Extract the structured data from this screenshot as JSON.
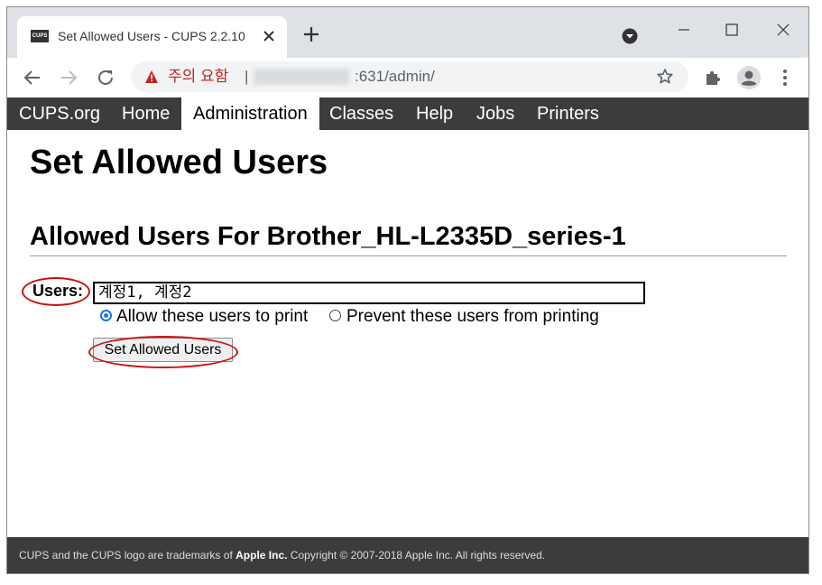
{
  "browser": {
    "tab_title": "Set Allowed Users - CUPS 2.2.10",
    "favicon_text": "CUPS",
    "security_warning": "주의 요함",
    "url_separator": "|",
    "url_path": ":631/admin/"
  },
  "nav": {
    "items": [
      {
        "label": "CUPS.org",
        "active": false
      },
      {
        "label": "Home",
        "active": false
      },
      {
        "label": "Administration",
        "active": true
      },
      {
        "label": "Classes",
        "active": false
      },
      {
        "label": "Help",
        "active": false
      },
      {
        "label": "Jobs",
        "active": false
      },
      {
        "label": "Printers",
        "active": false
      }
    ]
  },
  "page": {
    "title": "Set Allowed Users",
    "subtitle": "Allowed Users For Brother_HL-L2335D_series-1",
    "form": {
      "users_label": "Users:",
      "users_value": "계정1, 계정2",
      "allow_label": "Allow these users to print",
      "deny_label": "Prevent these users from printing",
      "allow_selected": true,
      "submit_label": "Set Allowed Users"
    }
  },
  "footer": {
    "text_before": "CUPS and the CUPS logo are trademarks of ",
    "brand": "Apple Inc.",
    "text_after": " Copyright © 2007-2018 Apple Inc. All rights reserved."
  },
  "colors": {
    "menubar": "#3c3c3c",
    "annotation": "#d01010",
    "warning": "#c5221f",
    "radio_accent": "#1a73e8"
  }
}
